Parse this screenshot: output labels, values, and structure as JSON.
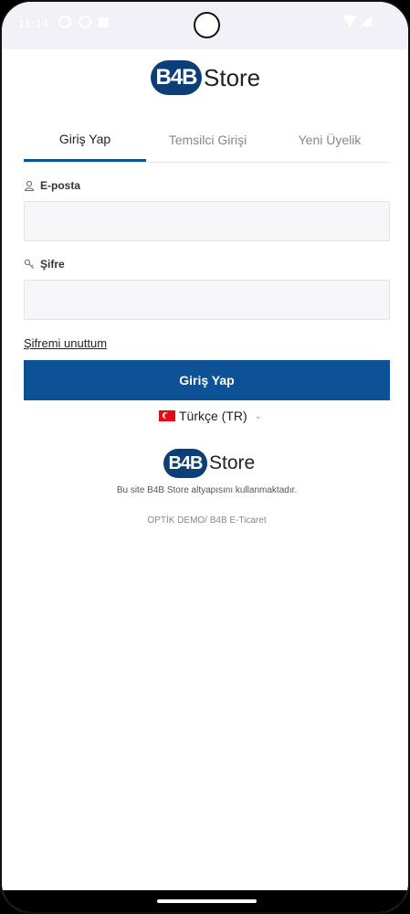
{
  "status_bar": {
    "time": "11:14"
  },
  "brand": {
    "badge": "B4B",
    "name": "Store",
    "color": "#0c3e78"
  },
  "tabs": [
    {
      "label": "Giriş Yap",
      "active": true
    },
    {
      "label": "Temsilci Girişi",
      "active": false
    },
    {
      "label": "Yeni Üyelik",
      "active": false
    }
  ],
  "form": {
    "email_label": "E-posta",
    "email_value": "",
    "password_label": "Şifre",
    "password_value": "",
    "forgot_label": "Şifremi unuttum",
    "submit_label": "Giriş Yap"
  },
  "language": {
    "selected": "Türkçe (TR)"
  },
  "footer": {
    "powered_by": "Bu site B4B Store altyapısını kullanmaktadır.",
    "site_info": "OPTİK DEMO/ B4B E-Ticaret"
  },
  "colors": {
    "primary": "#0d5296",
    "brand": "#0c3e78"
  }
}
